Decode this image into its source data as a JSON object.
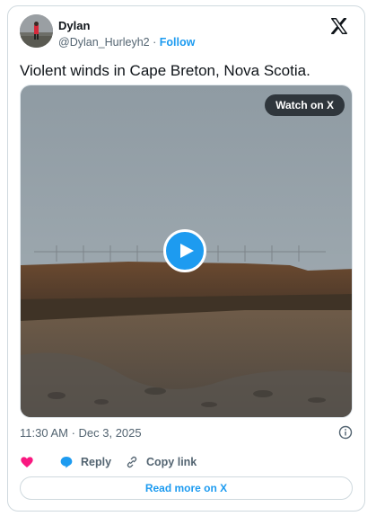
{
  "author": {
    "name": "Dylan",
    "handle": "@Dylan_Hurleyh2",
    "separator": "·",
    "follow_label": "Follow"
  },
  "tweet": {
    "text": "Violent winds in Cape Breton, Nova Scotia."
  },
  "media": {
    "watch_label": "Watch on X",
    "icon": "play-icon"
  },
  "meta": {
    "timestamp": "11:30 AM · Dec 3, 2025"
  },
  "actions": {
    "reply_label": "Reply",
    "copy_label": "Copy link",
    "read_more_label": "Read more on X"
  },
  "colors": {
    "accent": "#1d9bf0",
    "like": "#f91880",
    "text_secondary": "#536471"
  }
}
